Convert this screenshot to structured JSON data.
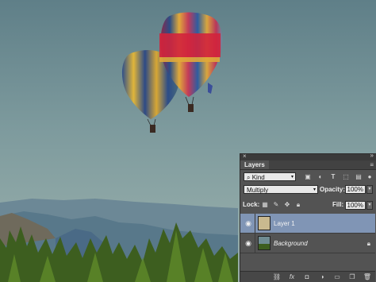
{
  "window": {
    "close_glyph": "×",
    "grip_glyph": "»"
  },
  "layers_panel": {
    "tab_label": "Layers",
    "menu_glyph": "≡",
    "filter": {
      "value": "Kind",
      "icons": [
        "image-filter-icon",
        "adjustment-filter-icon",
        "type-filter-icon",
        "shape-filter-icon",
        "smart-object-filter-icon",
        "filter-toggle-icon"
      ]
    },
    "blend_mode": "Multiply",
    "opacity_label": "Opacity:",
    "opacity_value": "100%",
    "lock_label": "Lock:",
    "lock_icons": [
      "lock-transparent-icon",
      "lock-image-icon",
      "lock-position-icon",
      "lock-all-icon"
    ],
    "fill_label": "Fill:",
    "fill_value": "100%",
    "layers": [
      {
        "name": "Layer 1",
        "selected": true,
        "visible": true
      },
      {
        "name": "Background",
        "selected": false,
        "visible": true,
        "locked": true
      }
    ],
    "bottom_icons": [
      "link-layers-icon",
      "fx-icon",
      "add-mask-icon",
      "adjustment-layer-icon",
      "new-group-icon",
      "new-layer-icon",
      "trash-icon"
    ]
  },
  "colors": {
    "selection": "#8095b5",
    "panel": "#535353"
  }
}
